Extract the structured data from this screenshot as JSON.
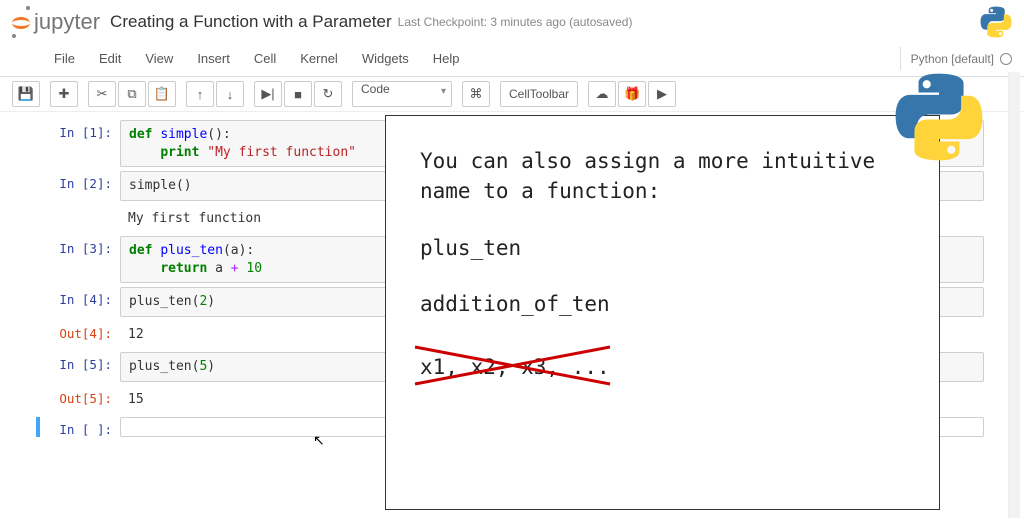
{
  "header": {
    "logo_text": "jupyter",
    "title": "Creating a Function with a Parameter",
    "checkpoint": "Last Checkpoint: 3 minutes ago (autosaved)"
  },
  "menubar": {
    "items": [
      "File",
      "Edit",
      "View",
      "Insert",
      "Cell",
      "Kernel",
      "Widgets",
      "Help"
    ],
    "kernel": "Python [default]"
  },
  "toolbar": {
    "cell_type": "Code",
    "cell_toolbar": "CellToolbar"
  },
  "cells": [
    {
      "in_prompt": "In [1]:",
      "code_html": "<span class='kw'>def</span> <span class='fn'>simple</span>():\n    <span class='kw'>print</span> <span class='str'>\"My first function\"</span>"
    },
    {
      "in_prompt": "In [2]:",
      "code_html": "simple()",
      "output_text": "My first function"
    },
    {
      "in_prompt": "In [3]:",
      "code_html": "<span class='kw'>def</span> <span class='fn'>plus_ten</span>(a):\n    <span class='kw'>return</span> a <span class='op'>+</span> <span class='num'>10</span>"
    },
    {
      "in_prompt": "In [4]:",
      "code_html": "plus_ten(<span class='num'>2</span>)",
      "out_prompt": "Out[4]:",
      "out_value": "12"
    },
    {
      "in_prompt": "In [5]:",
      "code_html": "plus_ten(<span class='num'>5</span>)",
      "out_prompt": "Out[5]:",
      "out_value": "15"
    },
    {
      "in_prompt": "In [ ]:",
      "code_html": "",
      "active": true
    }
  ],
  "overlay": {
    "line1": "You can also assign a more intuitive name to a function:",
    "line2": "plus_ten",
    "line3": "addition_of_ten",
    "line4": "x1, x2, x3, ..."
  }
}
